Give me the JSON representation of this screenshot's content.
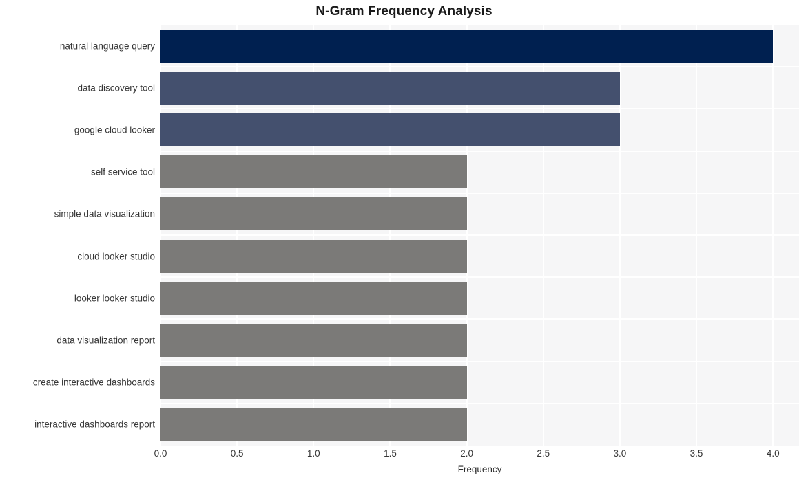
{
  "chart_data": {
    "type": "bar",
    "orientation": "horizontal",
    "title": "N-Gram Frequency Analysis",
    "xlabel": "Frequency",
    "ylabel": "",
    "xlim": [
      0.0,
      4.17
    ],
    "xticks": [
      0.0,
      0.5,
      1.0,
      1.5,
      2.0,
      2.5,
      3.0,
      3.5,
      4.0
    ],
    "xtick_labels": [
      "0.0",
      "0.5",
      "1.0",
      "1.5",
      "2.0",
      "2.5",
      "3.0",
      "3.5",
      "4.0"
    ],
    "grid": true,
    "grid_color": "#ffffff",
    "plot_background": "#f6f6f7",
    "figure_background": "#ffffff",
    "legend": null,
    "categories": [
      "natural language query",
      "data discovery tool",
      "google cloud looker",
      "self service tool",
      "simple data visualization",
      "cloud looker studio",
      "looker looker studio",
      "data visualization report",
      "create interactive dashboards",
      "interactive dashboards report"
    ],
    "values": [
      4,
      3,
      3,
      2,
      2,
      2,
      2,
      2,
      2,
      2
    ],
    "bar_colors": [
      "#002050",
      "#44506e",
      "#44506e",
      "#7b7a78",
      "#7b7a78",
      "#7b7a78",
      "#7b7a78",
      "#7b7a78",
      "#7b7a78",
      "#7b7a78"
    ],
    "bars": [
      {
        "label": "natural language query",
        "value": 4,
        "color": "#002050"
      },
      {
        "label": "data discovery tool",
        "value": 3,
        "color": "#44506e"
      },
      {
        "label": "google cloud looker",
        "value": 3,
        "color": "#44506e"
      },
      {
        "label": "self service tool",
        "value": 2,
        "color": "#7b7a78"
      },
      {
        "label": "simple data visualization",
        "value": 2,
        "color": "#7b7a78"
      },
      {
        "label": "cloud looker studio",
        "value": 2,
        "color": "#7b7a78"
      },
      {
        "label": "looker looker studio",
        "value": 2,
        "color": "#7b7a78"
      },
      {
        "label": "data visualization report",
        "value": 2,
        "color": "#7b7a78"
      },
      {
        "label": "create interactive dashboards",
        "value": 2,
        "color": "#7b7a78"
      },
      {
        "label": "interactive dashboards report",
        "value": 2,
        "color": "#7b7a78"
      }
    ]
  }
}
